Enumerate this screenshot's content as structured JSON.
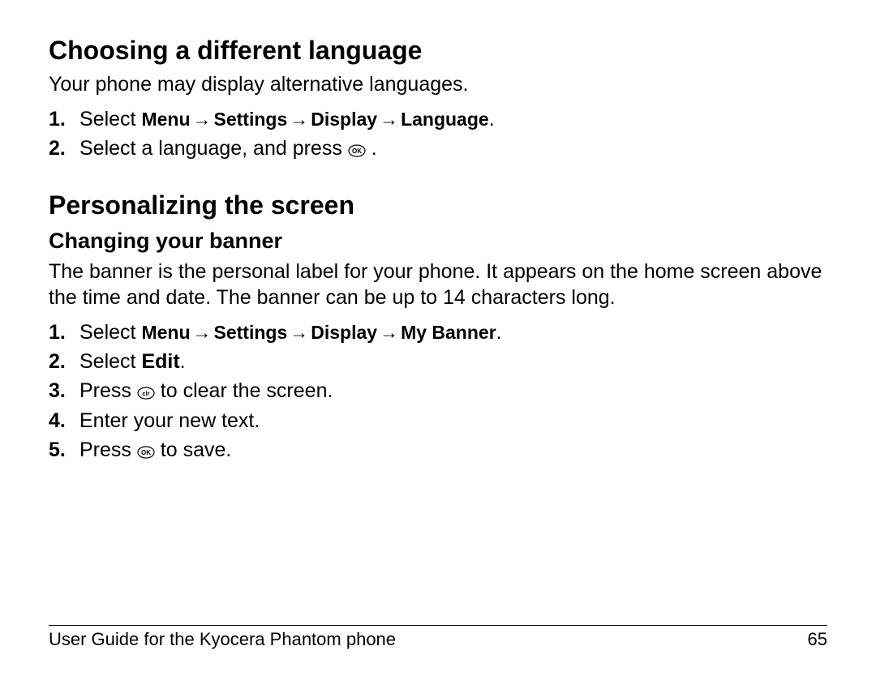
{
  "s1": {
    "heading": "Choosing a different language",
    "intro": "Your phone may display alternative languages.",
    "steps": {
      "n1": "1.",
      "s1_pre": "Select ",
      "s1_nav_menu": "Menu",
      "s1_nav_settings": "Settings",
      "s1_nav_display": "Display",
      "s1_nav_language": "Language",
      "s1_period": ".",
      "n2": "2.",
      "s2_pre": "Select a language, and press ",
      "s2_post": " ."
    }
  },
  "s2": {
    "heading": "Personalizing the screen",
    "sub1": {
      "heading": "Changing your banner",
      "intro": "The banner is the personal label for your phone. It appears on the home screen above the time and date. The banner can be up to 14 characters long.",
      "steps": {
        "n1": "1.",
        "s1_pre": "Select ",
        "s1_nav_menu": "Menu",
        "s1_nav_settings": "Settings",
        "s1_nav_display": "Display",
        "s1_nav_mybanner": "My Banner",
        "s1_period": ".",
        "n2": "2.",
        "s2_pre": "Select ",
        "s2_edit": "Edit",
        "s2_period": ".",
        "n3": "3.",
        "s3_pre": "Press ",
        "s3_post": " to clear the screen.",
        "n4": "4.",
        "s4": "Enter your new text.",
        "n5": "5.",
        "s5_pre": "Press ",
        "s5_post": " to save."
      }
    }
  },
  "arrow": "→",
  "icons": {
    "ok": "OK",
    "clr": "clr"
  },
  "footer": {
    "title": "User Guide for the Kyocera Phantom phone",
    "page": "65"
  }
}
